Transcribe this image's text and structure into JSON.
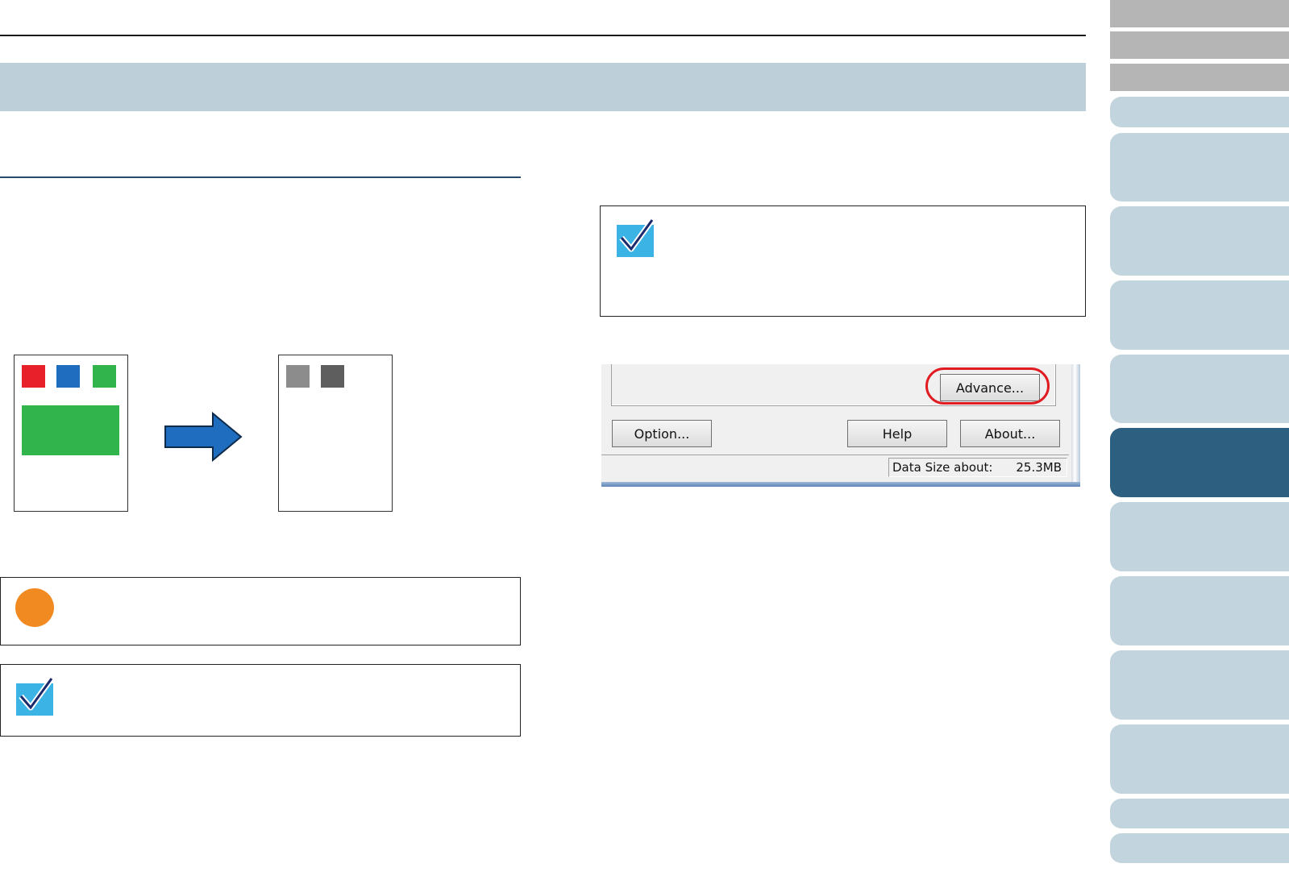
{
  "colors": {
    "title_band": "#bdd0da",
    "section_rule": "#2b4b6e",
    "tab_gray": "#b5b5b5",
    "tab_light_blue": "#c2d4de",
    "tab_active": "#2c5f80",
    "caution_orange": "#f28a22",
    "hint_check_blue": "#3bb4e5",
    "highlight_red": "#e01b22"
  },
  "illustration": {
    "source_swatches": [
      "#e8202a",
      "#1f6dbf",
      "#31b44b"
    ],
    "source_block": "#31b44b",
    "result_swatches": [
      "#8c8c8c",
      "#5e5e5e"
    ],
    "arrow_color": "#1f6dbf"
  },
  "icons": {
    "hint": "checkmark-icon",
    "caution": "caution-icon",
    "arrow": "right-arrow-icon"
  },
  "dialog": {
    "advance_label": "Advance...",
    "option_label": "Option...",
    "help_label": "Help",
    "about_label": "About...",
    "status_label": "Data Size about:",
    "status_value": "25.3MB"
  },
  "tabs": {
    "gray_count": 3,
    "blue_count": 10,
    "active_index": 5
  }
}
